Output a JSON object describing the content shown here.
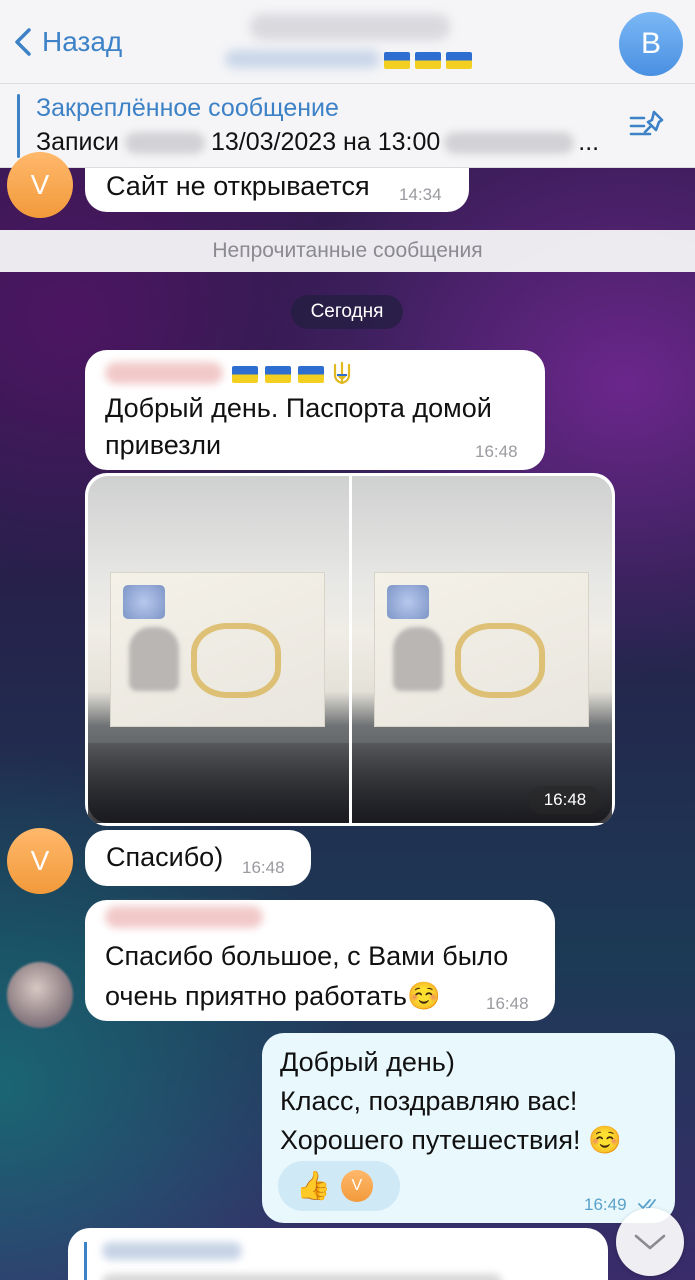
{
  "header": {
    "back_label": "Назад",
    "avatar_letter": "B"
  },
  "pinned": {
    "title": "Закреплённое сообщение",
    "text_prefix": "Записи",
    "text_date": "13/03/2023 на 13:00",
    "text_suffix": "..."
  },
  "messages": {
    "m1": {
      "avatar_letter": "V",
      "text": "Сайт не открывается",
      "time": "14:34"
    },
    "unread_label": "Непрочитанные сообщения",
    "date_label": "Сегодня",
    "m2": {
      "line1": "Добрый день. Паспорта домой",
      "line2": "привезли",
      "time": "16:48"
    },
    "media": {
      "time": "16:48"
    },
    "m3": {
      "avatar_letter": "V",
      "text": "Спасибо)",
      "time": "16:48"
    },
    "m4": {
      "line1": "Спасибо большое, с Вами было",
      "line2": "очень приятно работать☺️",
      "time": "16:48"
    },
    "m5": {
      "line1": "Добрый день)",
      "line2": "Класс, поздравляю вас!",
      "line3": "Хорошего путешествия! ☺️",
      "time": "16:49",
      "reaction_emoji": "👍",
      "reaction_avatar_letter": "V"
    }
  },
  "colors": {
    "accent": "#3d82c7",
    "outgoing_bubble": "#e9f8fd",
    "avatar_orange": "#f29a3b"
  }
}
